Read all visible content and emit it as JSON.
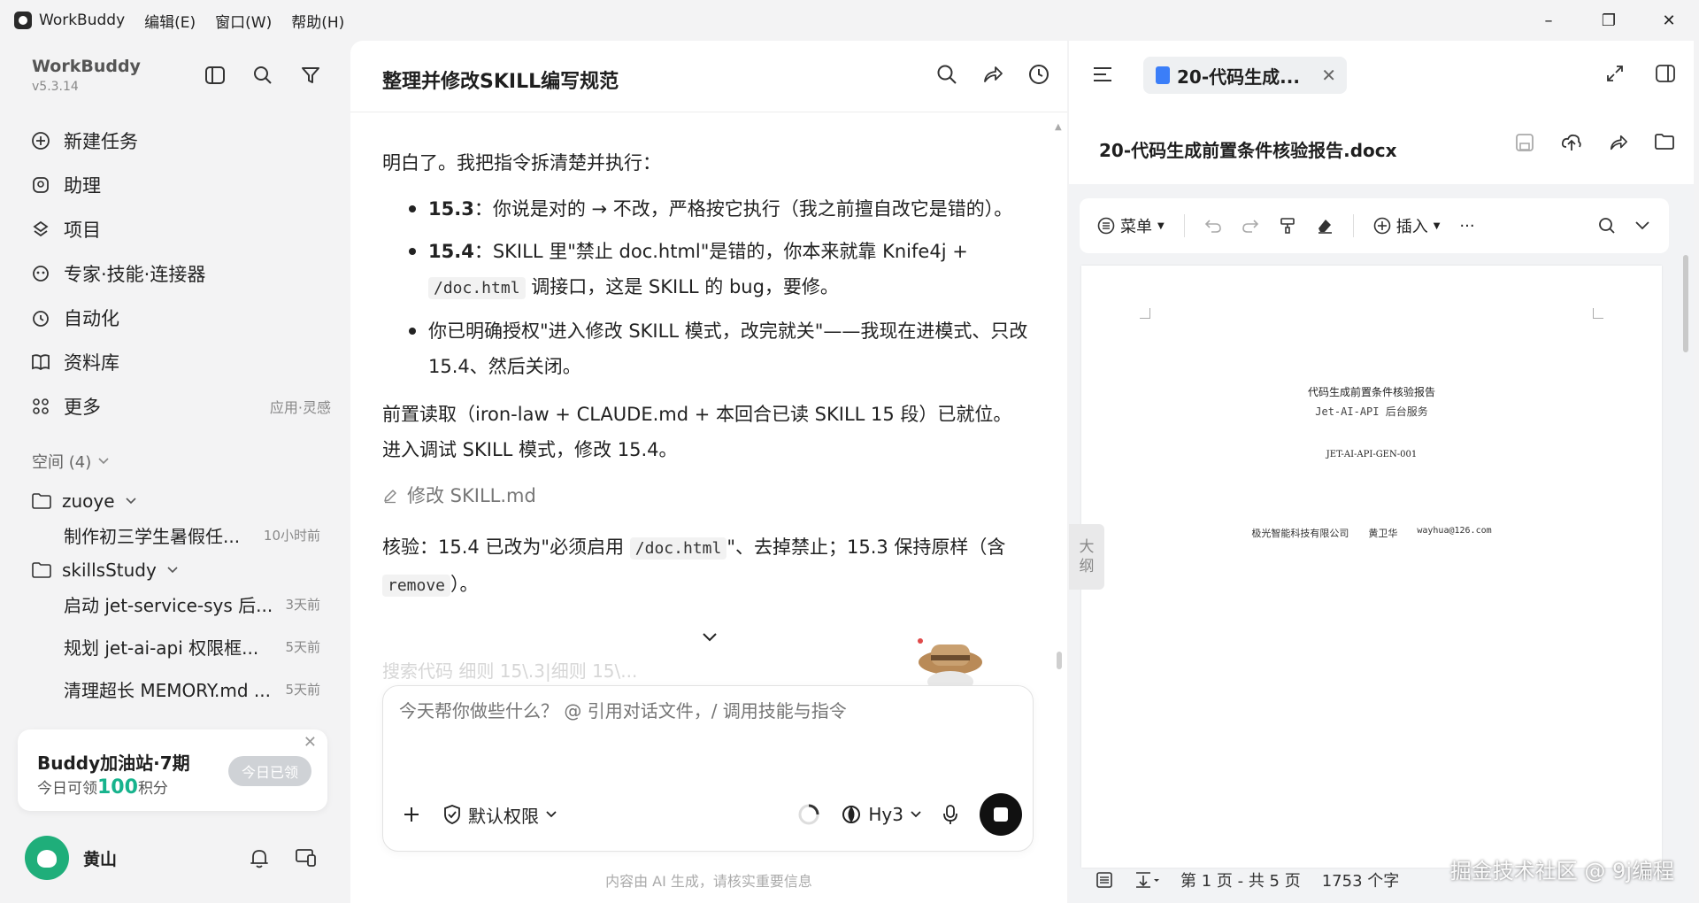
{
  "titlebar": {
    "app_name": "WorkBuddy",
    "menus": [
      "编辑(E)",
      "窗口(W)",
      "帮助(H)"
    ],
    "minimize": "–",
    "restore": "❐",
    "close": "✕"
  },
  "sidebar": {
    "brand": "WorkBuddy",
    "version": "v5.3.14",
    "nav": [
      {
        "label": "新建任务",
        "icon": "plus-circle-icon"
      },
      {
        "label": "助理",
        "icon": "assistant-icon"
      },
      {
        "label": "项目",
        "icon": "project-icon"
      },
      {
        "label": "专家·技能·连接器",
        "icon": "expert-icon"
      },
      {
        "label": "自动化",
        "icon": "clock-icon"
      },
      {
        "label": "资料库",
        "icon": "book-icon"
      },
      {
        "label": "更多",
        "icon": "grid-icon",
        "extra": "应用·灵感"
      }
    ],
    "space_label": "空间 (4)",
    "folders": [
      {
        "name": "zuoye",
        "tasks": [
          {
            "title": "制作初三学生暑假任...",
            "time": "10小时前"
          }
        ]
      },
      {
        "name": "skillsStudy",
        "tasks": [
          {
            "title": "启动 jet-service-sys 后...",
            "time": "3天前"
          },
          {
            "title": "规划 jet-ai-api 权限框...",
            "time": "5天前"
          },
          {
            "title": "清理超长 MEMORY.md ...",
            "time": "5天前"
          }
        ]
      }
    ],
    "promo": {
      "title": "Buddy加油站·7期",
      "sub_prefix": "今日可领",
      "points": "100",
      "sub_suffix": "积分",
      "button": "今日已领",
      "close": "✕"
    },
    "user": {
      "name": "黄山"
    }
  },
  "chat": {
    "title": "整理并修改SKILL编写规范",
    "intro": "明白了。我把指令拆清楚并执行：",
    "bullets": [
      {
        "bold": "15.3",
        "text": "：你说是对的 → 不改，严格按它执行（我之前擅自改它是错的）。"
      },
      {
        "bold": "15.4",
        "text_a": "：SKILL 里\"禁止 doc.html\"是错的，你本来就靠 Knife4j +",
        "code": "/doc.html",
        "text_b": " 调接口，这是 SKILL 的 bug，要修。"
      },
      {
        "text": "你已明确授权\"进入修改 SKILL 模式，改完就关\"——我现在进模式、只改 15.4、然后关闭。"
      }
    ],
    "para2": "前置读取（iron-law + CLAUDE.md + 本回合已读 SKILL 15 段）已就位。进入调试 SKILL 模式，修改 15.4。",
    "edit_action": "修改 SKILL.md",
    "verify_a": "核验：15.4 已改为\"必须启用 ",
    "verify_code1": "/doc.html",
    "verify_b": "\"、去掉禁止；15.3 保持原样（含 ",
    "verify_code2": "remove",
    "verify_c": "）。",
    "faded": "搜索代码 细则 15\\.3|细则 15\\...",
    "composer": {
      "placeholder": "今天帮你做些什么？ @ 引用对话文件，/ 调用技能与指令",
      "permission": "默认权限",
      "model": "Hy3"
    },
    "disclaimer": "内容由 AI 生成，请核实重要信息"
  },
  "doc": {
    "tab_title": "20-代码生成...",
    "file_name": "20-代码生成前置条件核验报告.docx",
    "toolbar": {
      "menu": "菜单",
      "insert": "插入",
      "more": "···"
    },
    "page": {
      "title": "代码生成前置条件核验报告",
      "subtitle": "Jet-AI-API 后台服务",
      "doc_id": "JET-AI-API-GEN-001",
      "company": "极光智能科技有限公司",
      "author": "黄卫华",
      "email": "wayhua@126.com"
    },
    "outline": [
      "大",
      "纲"
    ],
    "status": {
      "pages": "第 1 页 - 共 5 页",
      "words": "1753 个字"
    },
    "watermark": "掘金技术社区 @ 9j编程"
  }
}
